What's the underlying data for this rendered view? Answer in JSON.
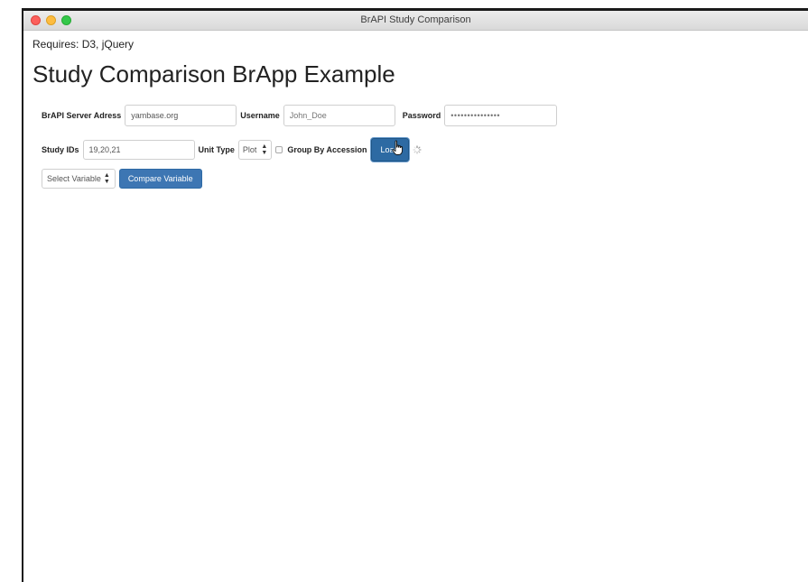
{
  "window": {
    "title": "BrAPI Study Comparison"
  },
  "page": {
    "requires": "Requires: D3, jQuery",
    "heading": "Study Comparison BrApp Example"
  },
  "server": {
    "label": "BrAPI Server Adress",
    "value": "yambase.org"
  },
  "username": {
    "label": "Username",
    "placeholder": "John_Doe"
  },
  "password": {
    "label": "Password",
    "placeholder": "•••••••••••••••"
  },
  "study": {
    "label": "Study IDs",
    "value": "19,20,21"
  },
  "unit_type": {
    "label": "Unit Type",
    "selected": "Plot"
  },
  "group_by": {
    "label": "Group By Accession",
    "checked": false
  },
  "load_button": {
    "label": "Load"
  },
  "variable_select": {
    "selected": "Select Variable"
  },
  "compare_button": {
    "label": "Compare Variable"
  },
  "colors": {
    "button": "#3d76b3",
    "button_active": "#2d6aa3",
    "close": "#fc605c",
    "minimize": "#fdbc40",
    "maximize": "#34c84a"
  },
  "icons": {
    "spinner": "loading-spinner-icon",
    "cursor": "hand-pointer-cursor-icon"
  }
}
